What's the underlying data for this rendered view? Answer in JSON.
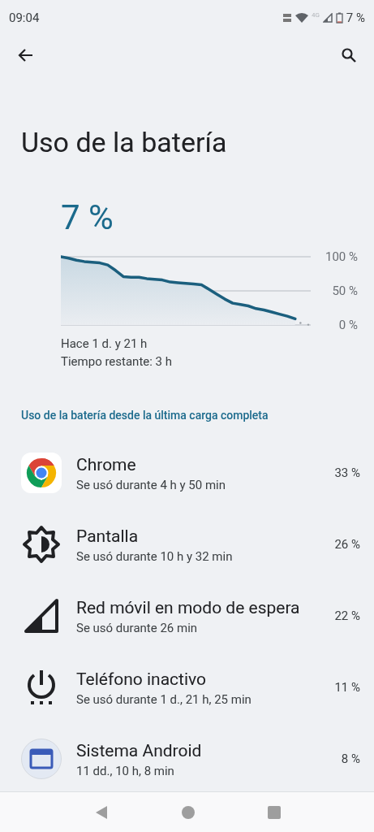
{
  "status_bar": {
    "time": "09:04",
    "network": "4G",
    "battery": "7 %"
  },
  "page": {
    "title": "Uso de la batería"
  },
  "battery": {
    "percent": "7 %",
    "since": "Hace 1 d. y 21 h",
    "remaining": "Tiempo restante: 3 h",
    "chart_data": {
      "type": "area",
      "categories": [
        null,
        null,
        null,
        null,
        null,
        null,
        null,
        null,
        null,
        null,
        null,
        null,
        null,
        null,
        null,
        null,
        null,
        null,
        null,
        null,
        null,
        null,
        null,
        null,
        null,
        null,
        null,
        null,
        null,
        null,
        null
      ],
      "ylim": [
        0,
        100
      ],
      "yticks": [
        {
          "value": 100,
          "label": "100 %"
        },
        {
          "value": 50,
          "label": "50 %"
        },
        {
          "value": 0,
          "label": "0 %"
        }
      ],
      "series": [
        {
          "color": "#1b5f7e",
          "values": [
            100,
            98,
            95,
            93,
            92,
            91,
            88,
            80,
            71,
            70,
            70,
            68,
            67,
            66,
            63,
            62,
            61,
            60,
            59,
            52,
            45,
            38,
            32,
            30,
            28,
            24,
            22,
            19,
            16,
            13,
            9
          ]
        }
      ]
    }
  },
  "section_title": "Uso de la batería desde la última carga completa",
  "apps": [
    {
      "kind": "chrome",
      "name": "Chrome",
      "usage": "Se usó durante 4 h y 50 min",
      "percent": "33 %"
    },
    {
      "kind": "screen",
      "name": "Pantalla",
      "usage": "Se usó durante 10 h y 32 min",
      "percent": "26 %"
    },
    {
      "kind": "signal",
      "name": "Red móvil en modo de espera",
      "usage": "Se usó durante 26 min",
      "percent": "22 %"
    },
    {
      "kind": "power",
      "name": "Teléfono inactivo",
      "usage": "Se usó durante 1 d., 21 h, 25 min",
      "percent": "11 %"
    },
    {
      "kind": "system",
      "name": "Sistema Android",
      "usage": "11 dd., 10 h, 8 min",
      "percent": "8 %"
    }
  ]
}
